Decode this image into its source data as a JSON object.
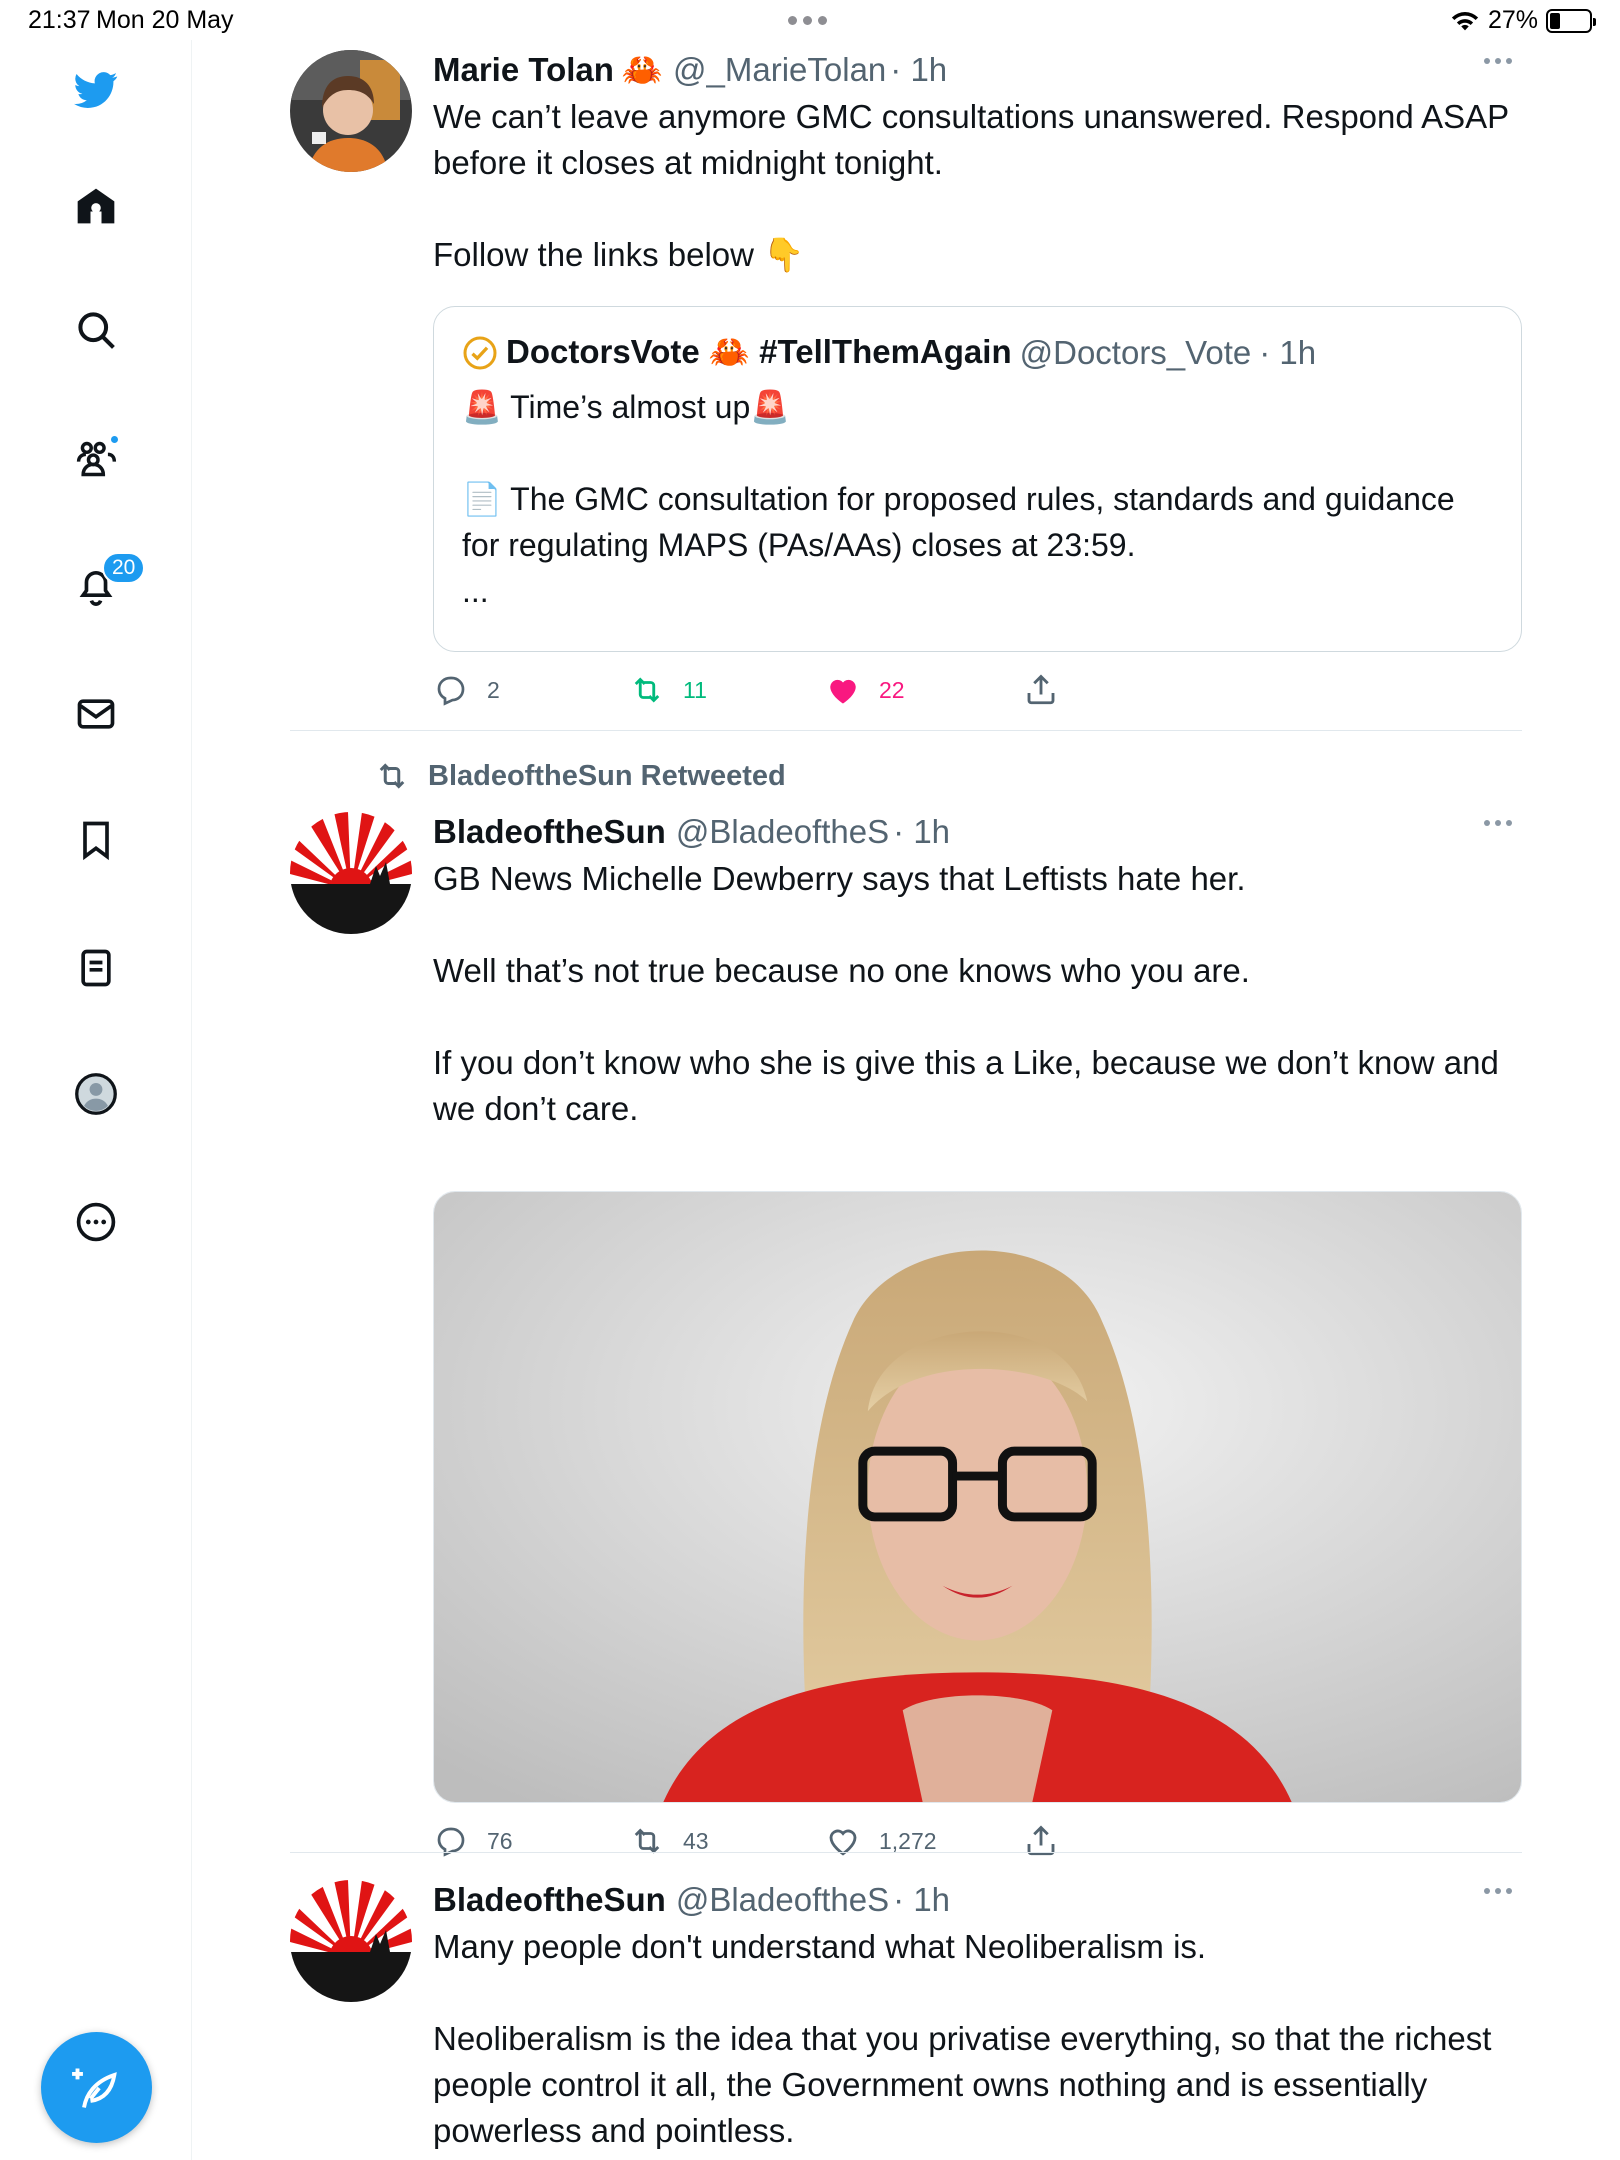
{
  "status_bar": {
    "time": "21:37",
    "date": "Mon 20 May",
    "battery": "27%",
    "battery_level": 0.27
  },
  "sidebar": {
    "notifications_badge": "20",
    "items": [
      "home",
      "search",
      "communities",
      "notifications",
      "messages",
      "bookmarks",
      "lists",
      "profile",
      "more"
    ]
  },
  "tweets": [
    {
      "name": "Marie Tolan",
      "name_emoji": "🦀",
      "handle": "@_MarieTolan",
      "time": "· 1h",
      "text": [
        "We can’t leave anymore GMC consultations unanswered. Respond ASAP before it closes at midnight tonight.",
        "",
        "Follow the links below 👇"
      ],
      "quote": {
        "name": "DoctorsVote 🦀 #TellThemAgain",
        "handle": "@Doctors_Vote",
        "time": "· 1h",
        "text": [
          "🚨 Time’s almost up🚨",
          "",
          "📄 The GMC consultation for proposed rules, standards and guidance for regulating MAPS (PAs/AAs) closes at 23:59.",
          "..."
        ]
      },
      "replies": "2",
      "retweets": "11",
      "likes": "22"
    },
    {
      "retweeted_by": "BladeoftheSun Retweeted",
      "name": "BladeoftheSun",
      "handle": "@BladeoftheS",
      "time": "· 1h",
      "text": [
        "GB News Michelle Dewberry says that Leftists hate her.",
        "",
        "Well that’s not true because no one knows who you are.",
        "",
        "If you don’t know who she is give this a Like, because we don’t know and we don’t care."
      ],
      "replies": "76",
      "retweets": "43",
      "likes": "1,272"
    },
    {
      "name": "BladeoftheSun",
      "handle": "@BladeoftheS",
      "time": "· 1h",
      "text": [
        "Many people don't understand what Neoliberalism is.",
        "",
        "Neoliberalism is the idea that you privatise everything, so that the richest people control it all, the Government owns nothing and is essentially powerless and pointless."
      ]
    }
  ],
  "colors": {
    "accent": "#1d9bf0",
    "retweet_active": "#00ba7c",
    "like_active": "#f91880",
    "muted": "#536471"
  }
}
